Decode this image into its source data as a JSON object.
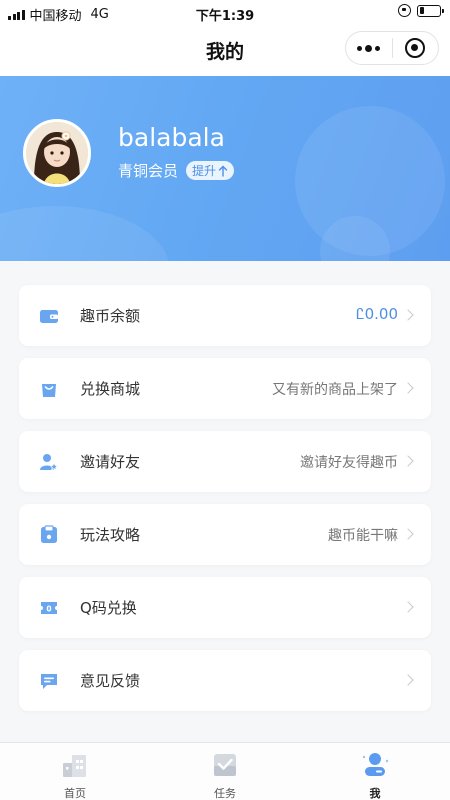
{
  "status_bar": {
    "carrier": "中国移动",
    "network": "4G",
    "time": "下午1:39",
    "battery_level": 0.2
  },
  "nav": {
    "title": "我的",
    "more_icon": "more-dots-icon",
    "close_icon": "target-icon"
  },
  "profile": {
    "username": "balabala",
    "level": "青铜会员",
    "upgrade_label": "提升",
    "upgrade_icon": "arrow-up-icon"
  },
  "menu": [
    {
      "label": "趣币余额",
      "value": "Ꮭ0.00",
      "icon": "wallet-icon"
    },
    {
      "label": "兑换商城",
      "value": "又有新的商品上架了",
      "icon": "shopping-bag-icon"
    },
    {
      "label": "邀请好友",
      "value": "邀请好友得趣币",
      "icon": "user-star-icon"
    },
    {
      "label": "玩法攻略",
      "value": "趣币能干嘛",
      "icon": "guide-book-icon"
    },
    {
      "label": "Q码兑换",
      "value": "",
      "icon": "ticket-icon"
    },
    {
      "label": "意见反馈",
      "value": "",
      "icon": "feedback-message-icon"
    }
  ],
  "tabbar": {
    "items": [
      {
        "label": "首页",
        "icon": "home-buildings-icon"
      },
      {
        "label": "任务",
        "icon": "task-check-icon"
      },
      {
        "label": "我",
        "icon": "profile-icon",
        "active": true
      }
    ]
  },
  "colors": {
    "accent": "#4f8fe2",
    "banner_start": "#6fb1f8",
    "banner_end": "#5e9ef0",
    "icon_blue": "#6aa6f0"
  }
}
